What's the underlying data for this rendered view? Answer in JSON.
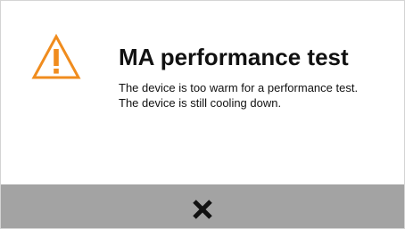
{
  "dialog": {
    "title": "MA performance test",
    "message_lines": [
      "The device is too warm for a performance test.",
      "The device is still cooling down."
    ],
    "icon": "warning-triangle-icon",
    "close_icon": "close-x-icon"
  },
  "colors": {
    "warning": "#f08c1e",
    "footer": "#a3a3a3",
    "text": "#111111",
    "close": "#111111"
  }
}
